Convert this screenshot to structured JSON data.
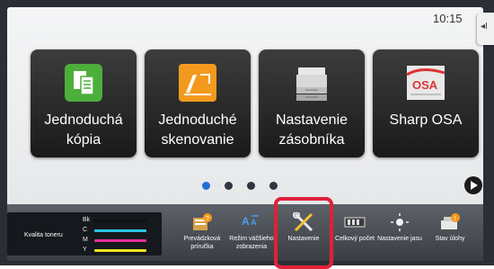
{
  "status": {
    "time": "10:15",
    "side_tab_glyph": "◂I"
  },
  "tiles": [
    {
      "label": "Jednoduchá kópia",
      "icon": "copy-icon",
      "color": "#4caf3c"
    },
    {
      "label": "Jednoduché skenovanie",
      "icon": "scan-icon",
      "color": "#f39a1e"
    },
    {
      "label": "Nastavenie zásobníka",
      "icon": "printer-tray-icon",
      "color": "#cfcfcf"
    },
    {
      "label": "Sharp OSA",
      "icon": "sharp-osa-icon",
      "color": "#d33"
    }
  ],
  "pager": {
    "pages": 5,
    "current": 1
  },
  "toner": {
    "title": "Kvalita toneru",
    "levels": [
      {
        "label": "Bk",
        "color": "#111111",
        "level": 1.0
      },
      {
        "label": "C",
        "color": "#2ec4e6",
        "level": 1.0
      },
      {
        "label": "M",
        "color": "#e0309a",
        "level": 1.0
      },
      {
        "label": "Y",
        "color": "#f5e21a",
        "level": 1.0
      }
    ]
  },
  "shortcuts": [
    {
      "label": "Prevádzková príručka",
      "icon": "manual-icon"
    },
    {
      "label": "Režim väčšieho zobrazenia",
      "icon": "large-display-icon"
    },
    {
      "label": "Nastavenie",
      "icon": "settings-tools-icon"
    },
    {
      "label": "Celkový počet",
      "icon": "counter-icon"
    },
    {
      "label": "Nastavenie jasu",
      "icon": "brightness-icon"
    },
    {
      "label": "Stav úlohy",
      "icon": "job-status-icon"
    }
  ],
  "highlight_color": "#e0203a"
}
